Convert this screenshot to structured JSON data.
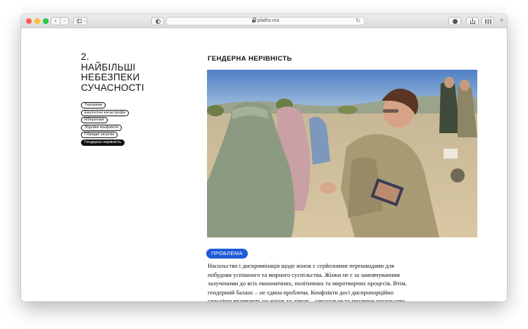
{
  "browser": {
    "url": "platfor.ma",
    "icons": [
      "back-icon",
      "forward-icon",
      "sidebar-icon",
      "shield-icon",
      "lock-icon",
      "reload-icon",
      "download-icon",
      "share-icon",
      "tabs-icon",
      "new-tab-icon"
    ],
    "back_glyph": "‹",
    "forward_glyph": "›",
    "reload_glyph": "↻",
    "plus_glyph": "+"
  },
  "section": {
    "number": "2.",
    "title": "НАЙБІЛЬШІ\nНЕБЕЗПЕКИ\nСУЧАСНОСТІ",
    "menu": [
      {
        "label": "Тероризм",
        "active": false
      },
      {
        "label": "Екологічні катастрофи",
        "active": false
      },
      {
        "label": "Кібератаки",
        "active": false
      },
      {
        "label": "Збройні конфлікти",
        "active": false
      },
      {
        "label": "Гібридні загрози",
        "active": false
      },
      {
        "label": "Гендерна нерівність",
        "active": true
      }
    ]
  },
  "article": {
    "heading": "ГЕНДЕРНА НЕРІВНІСТЬ",
    "badge": "ПРОБЛЕМА",
    "body": "Насильство і дискримінація щодо жінок є серйозними перешкодами для побудови успішного та мирного суспільства. Жінки не є за замовчуванням залученими до всіх економічних, політичних та миротворчих процесів. Втім, гендерний баланс – не єдина проблема. Конфлікти досі диспропорційно сильніше впливають на жінок та дівчат – сексуальне та гендерне насильство потрібно розпізнавати, запобігати йому і реагувати на нього."
  },
  "colors": {
    "accent": "#1f5bd8",
    "text": "#111111"
  }
}
